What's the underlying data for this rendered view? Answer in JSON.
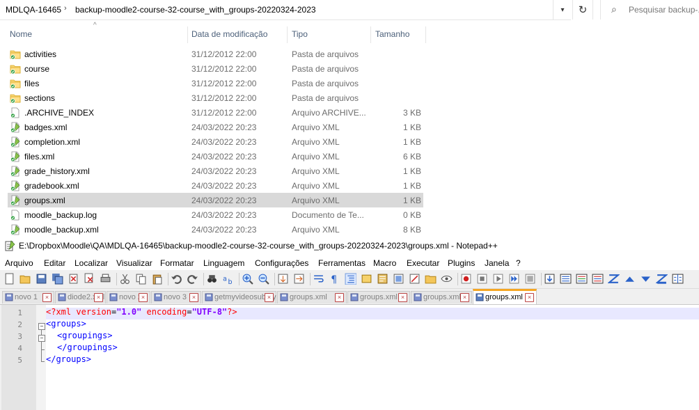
{
  "explorer": {
    "breadcrumb": [
      "MDLQA-16465",
      "backup-moodle2-course-32-course_with_groups-20220324-2023"
    ],
    "search_placeholder": "Pesquisar backup-...",
    "columns": {
      "name": "Nome",
      "date": "Data de modificação",
      "type": "Tipo",
      "size": "Tamanho"
    },
    "files": [
      {
        "name": "activities",
        "date": "31/12/2012 22:00",
        "type": "Pasta de arquivos",
        "size": "",
        "kind": "folder"
      },
      {
        "name": "course",
        "date": "31/12/2012 22:00",
        "type": "Pasta de arquivos",
        "size": "",
        "kind": "folder"
      },
      {
        "name": "files",
        "date": "31/12/2012 22:00",
        "type": "Pasta de arquivos",
        "size": "",
        "kind": "folder"
      },
      {
        "name": "sections",
        "date": "31/12/2012 22:00",
        "type": "Pasta de arquivos",
        "size": "",
        "kind": "folder"
      },
      {
        "name": ".ARCHIVE_INDEX",
        "date": "31/12/2012 22:00",
        "type": "Arquivo ARCHIVE...",
        "size": "3 KB",
        "kind": "file"
      },
      {
        "name": "badges.xml",
        "date": "24/03/2022 20:23",
        "type": "Arquivo XML",
        "size": "1 KB",
        "kind": "xml"
      },
      {
        "name": "completion.xml",
        "date": "24/03/2022 20:23",
        "type": "Arquivo XML",
        "size": "1 KB",
        "kind": "xml"
      },
      {
        "name": "files.xml",
        "date": "24/03/2022 20:23",
        "type": "Arquivo XML",
        "size": "6 KB",
        "kind": "xml"
      },
      {
        "name": "grade_history.xml",
        "date": "24/03/2022 20:23",
        "type": "Arquivo XML",
        "size": "1 KB",
        "kind": "xml"
      },
      {
        "name": "gradebook.xml",
        "date": "24/03/2022 20:23",
        "type": "Arquivo XML",
        "size": "1 KB",
        "kind": "xml"
      },
      {
        "name": "groups.xml",
        "date": "24/03/2022 20:23",
        "type": "Arquivo XML",
        "size": "1 KB",
        "kind": "xml",
        "selected": true
      },
      {
        "name": "moodle_backup.log",
        "date": "24/03/2022 20:23",
        "type": "Documento de Te...",
        "size": "0 KB",
        "kind": "file"
      },
      {
        "name": "moodle_backup.xml",
        "date": "24/03/2022 20:23",
        "type": "Arquivo XML",
        "size": "8 KB",
        "kind": "xml"
      }
    ]
  },
  "notepad": {
    "title": "E:\\Dropbox\\Moodle\\QA\\MDLQA-16465\\backup-moodle2-course-32-course_with_groups-20220324-2023\\groups.xml - Notepad++",
    "menu": [
      "Arquivo",
      "Editar",
      "Localizar",
      "Visualizar",
      "Formatar",
      "Linguagem",
      "Configurações",
      "Ferramentas",
      "Macro",
      "Executar",
      "Plugins",
      "Janela",
      "?"
    ],
    "tabs": [
      {
        "label": "novo 1",
        "active": false
      },
      {
        "label": "diode2.xml",
        "active": false
      },
      {
        "label": "novo 2",
        "active": false
      },
      {
        "label": "novo 3",
        "active": false
      },
      {
        "label": "getmyvideosub.py",
        "active": false
      },
      {
        "label": "groups.xml",
        "active": false
      },
      {
        "label": "groups.xml",
        "active": false
      },
      {
        "label": "groups.xml",
        "active": false
      },
      {
        "label": "groups.xml",
        "active": true
      }
    ],
    "lines": [
      {
        "num": "1",
        "pi_open": "<?",
        "tag": "xml",
        "attr1": "version",
        "val1": "\"1.0\"",
        "attr2": "encoding",
        "val2": "\"UTF-8\"",
        "pi_close": "?>"
      },
      {
        "num": "2",
        "text": "<groups>"
      },
      {
        "num": "3",
        "text": "<groupings>"
      },
      {
        "num": "4",
        "text": "</groupings>"
      },
      {
        "num": "5",
        "text": "</groups>"
      }
    ]
  },
  "colors": {
    "selection": "#d9d9d9",
    "tab_accent": "#f5a623",
    "xml_tag": "#0000ff",
    "xml_attr": "#ff0000",
    "xml_value": "#8000ff"
  }
}
